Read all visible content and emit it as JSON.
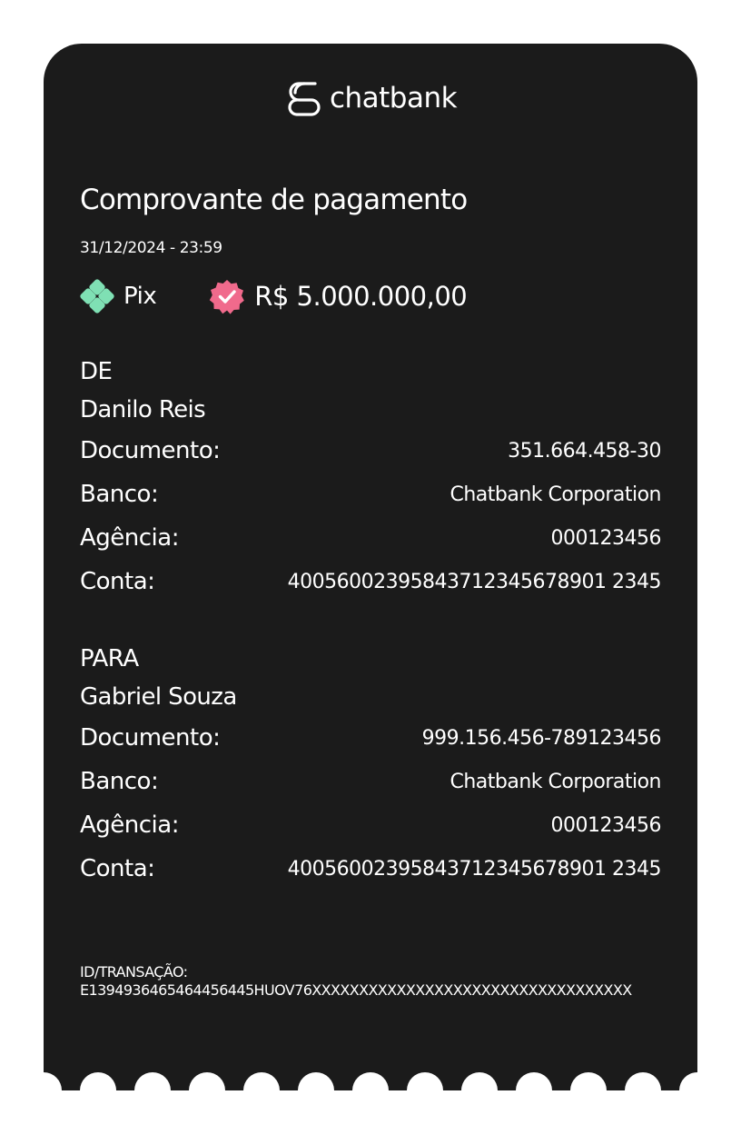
{
  "brand": {
    "name": "chatbank"
  },
  "receipt": {
    "title": "Comprovante de pagamento",
    "datetime": "31/12/2024 - 23:59",
    "method": "Pix",
    "amount": "R$ 5.000.000,00"
  },
  "from": {
    "label": "DE",
    "name": "Danilo Reis",
    "rows": [
      {
        "label": "Documento:",
        "value": "351.664.458-30"
      },
      {
        "label": "Banco:",
        "value": "Chatbank Corporation"
      },
      {
        "label": "Agência:",
        "value": "000123456"
      },
      {
        "label": "Conta:",
        "value": "40056002395843712345678901 2345"
      }
    ]
  },
  "to": {
    "label": "PARA",
    "name": "Gabriel Souza",
    "rows": [
      {
        "label": "Documento:",
        "value": "999.156.456-789123456"
      },
      {
        "label": "Banco:",
        "value": "Chatbank Corporation"
      },
      {
        "label": "Agência:",
        "value": "000123456"
      },
      {
        "label": "Conta:",
        "value": "40056002395843712345678901 2345"
      }
    ]
  },
  "transaction": {
    "label": "ID/TRANSAÇÃO:",
    "id": "E1394936465464456445HUOV76XXXXXXXXXXXXXXXXXXXXXXXXXXXXXXXXXX"
  },
  "colors": {
    "card_background": "#1b1b1b",
    "text": "#ffffff",
    "pix_icon": "#7fe0b4",
    "verified_badge": "#f06a8c"
  },
  "icons": {
    "logo": "chatbank-logo-icon",
    "pix": "pix-icon",
    "verified": "verified-badge-icon"
  }
}
